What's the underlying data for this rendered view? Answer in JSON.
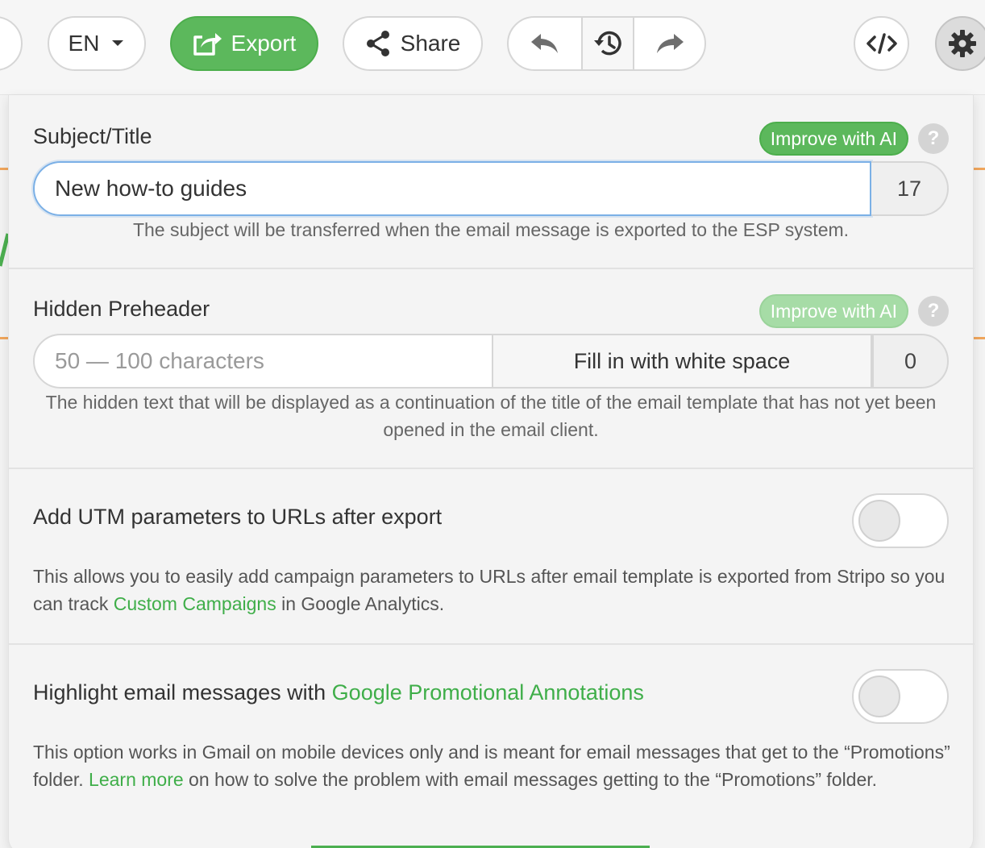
{
  "toolbar": {
    "language": "EN",
    "export_label": "Export",
    "share_label": "Share"
  },
  "subject": {
    "label": "Subject/Title",
    "ai_label": "Improve with AI",
    "help": "?",
    "value": "New how-to guides",
    "count": "17",
    "hint": "The subject will be transferred when the email message is exported to the ESP system."
  },
  "preheader": {
    "label": "Hidden Preheader",
    "ai_label": "Improve with AI",
    "help": "?",
    "placeholder": "50 — 100 characters",
    "fill_label": "Fill in with white space",
    "count": "0",
    "hint": "The hidden text that will be displayed as a continuation of the title of the email template that has not yet been opened in the email client."
  },
  "utm": {
    "label": "Add UTM parameters to URLs after export",
    "enabled": false,
    "desc_before": "This allows you to easily add campaign parameters to URLs after email template is exported from Stripo so you can track ",
    "desc_link": "Custom Campaigns",
    "desc_after": " in Google Analytics."
  },
  "annotations": {
    "label_before": "Highlight email messages with ",
    "label_link": "Google Promotional Annotations",
    "enabled": false,
    "desc_before": "This option works in Gmail on mobile devices only and is meant for email messages that get to the “Promotions” folder. ",
    "desc_link": "Learn more",
    "desc_after": " on how to solve the problem with email messages getting to the “Promotions” folder."
  },
  "colors": {
    "accent": "#5cb85c",
    "link": "#3fae49",
    "focus": "#7bb0e6"
  }
}
